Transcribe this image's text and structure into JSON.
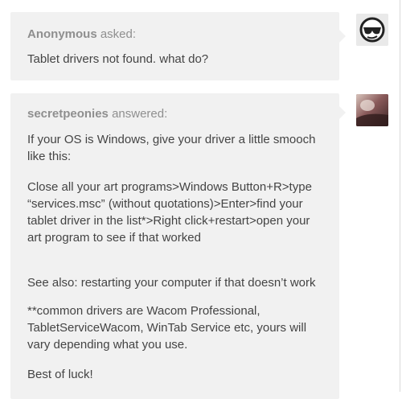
{
  "question": {
    "asker_name": "Anonymous",
    "asked_label": "asked:",
    "text": "Tablet drivers not found. what do?"
  },
  "answer": {
    "answerer_name": "secretpeonies",
    "answered_label": "answered:",
    "paragraphs": [
      "If your OS is Windows, give your driver a little smooch like this:",
      "Close all your art programs>Windows Button+R>type “services.msc” (without quotations)>Enter>find your tablet driver in the list*>Right click+restart>open your art program to see if that worked",
      "See also: restarting your computer if that doesn’t work",
      "**common drivers are Wacom Professional, TabletServiceWacom, WinTab Service etc, yours will vary depending what you use.",
      "Best of luck!"
    ]
  },
  "avatars": {
    "asker_icon": "sunglasses-face-icon",
    "answerer_icon": "photo-avatar"
  },
  "colors": {
    "bubble_bg": "#f1f1f1",
    "text": "#444444",
    "meta": "#8f8f8f"
  }
}
